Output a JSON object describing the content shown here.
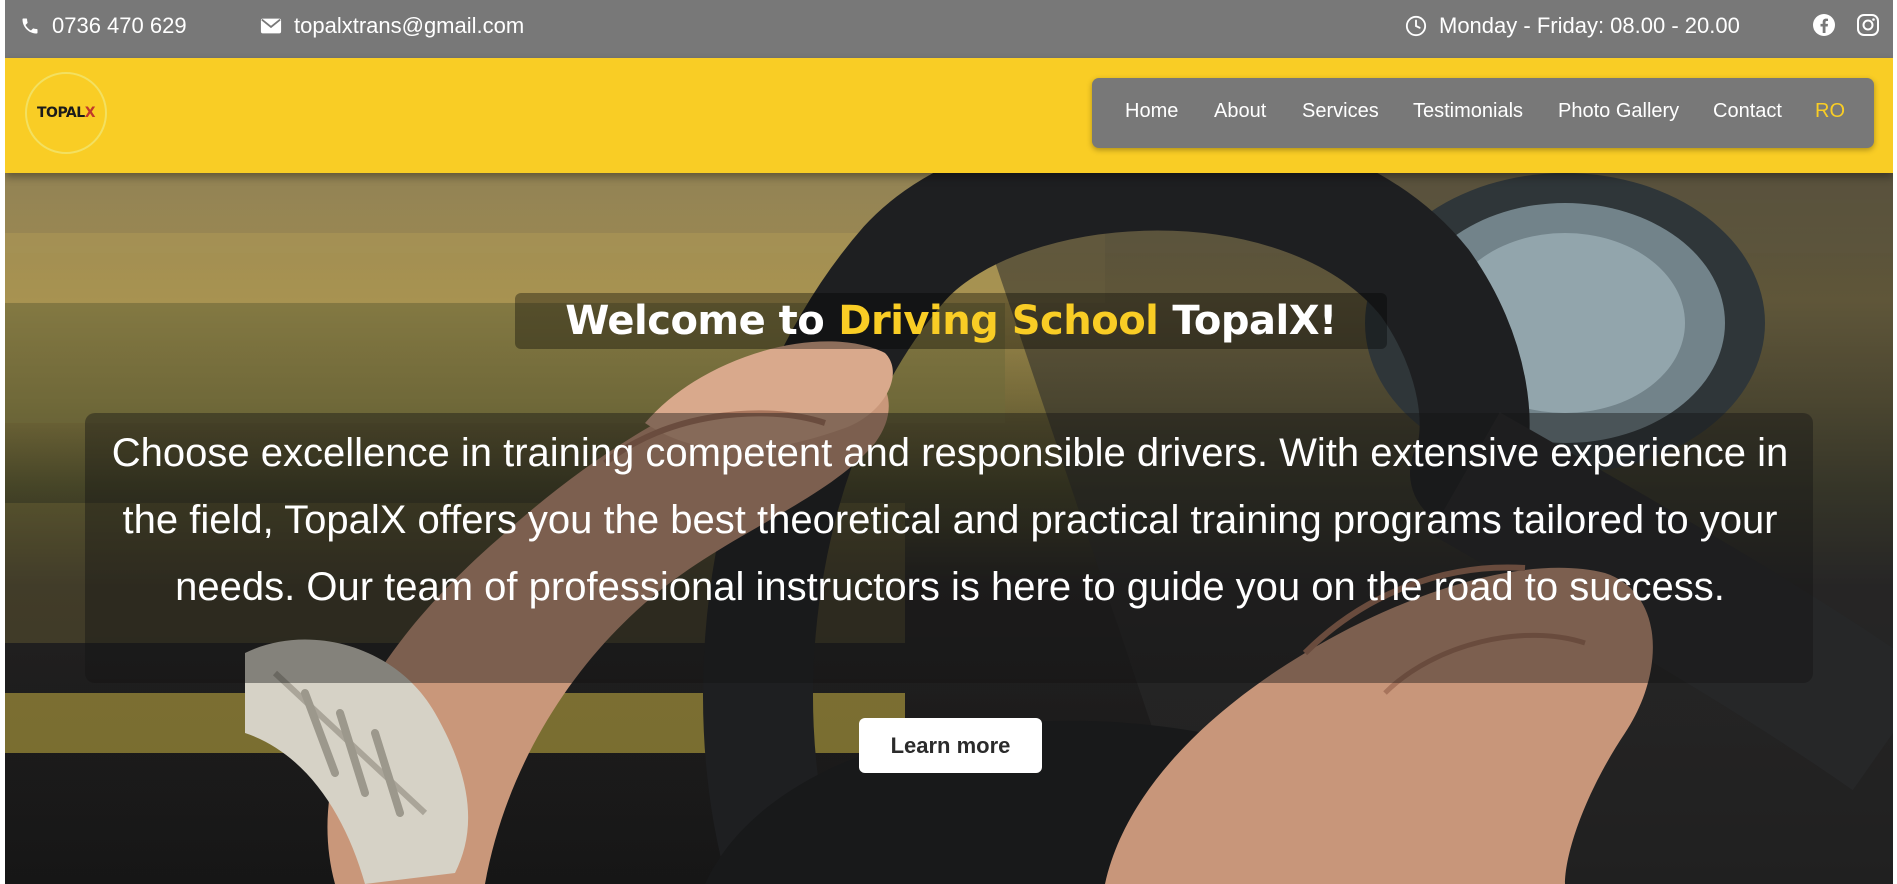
{
  "topbar": {
    "phone": "0736 470 629",
    "email": "topalxtrans@gmail.com",
    "hours": "Monday - Friday: 08.00 - 20.00",
    "icons": [
      "phone-icon",
      "envelope-icon",
      "clock-icon",
      "facebook-icon",
      "instagram-icon"
    ]
  },
  "header": {
    "logo": {
      "main": "TOPAL",
      "accent": "X"
    },
    "nav": [
      {
        "label": "Home"
      },
      {
        "label": "About"
      },
      {
        "label": "Services"
      },
      {
        "label": "Testimonials"
      },
      {
        "label": "Photo Gallery"
      },
      {
        "label": "Contact"
      },
      {
        "label": "RO"
      }
    ]
  },
  "hero": {
    "welcome_prefix": "Welcome to",
    "welcome_accent": "Driving School",
    "welcome_suffix": "TopalX!",
    "intro": "Choose excellence in training competent and responsible drivers. With extensive experience in the field, TopalX offers you the best theoretical and practical training programs tailored to your needs. Our team of professional instructors is here to guide you on the road to success.",
    "cta": "Learn more"
  },
  "colors": {
    "brand_yellow": "#f9cd25",
    "bar_gray": "#787878",
    "text_white": "#ffffff"
  }
}
